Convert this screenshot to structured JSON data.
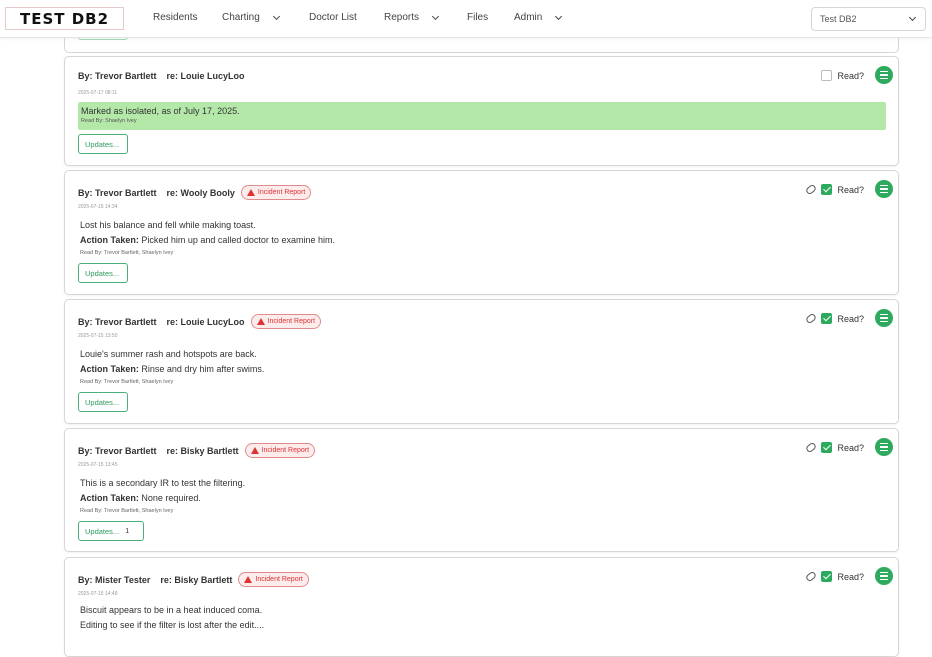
{
  "navbar": {
    "logo": "TEST DB2",
    "items": [
      {
        "label": "Residents",
        "has_dropdown": false
      },
      {
        "label": "Charting",
        "has_dropdown": true
      },
      {
        "label": "Doctor List",
        "has_dropdown": false
      },
      {
        "label": "Reports",
        "has_dropdown": true
      },
      {
        "label": "Files",
        "has_dropdown": false
      },
      {
        "label": "Admin",
        "has_dropdown": true
      }
    ],
    "site_select": "Test DB2"
  },
  "labels": {
    "read": "Read?",
    "updates": "Updates...",
    "incident_badge": "Incident Report",
    "action_taken": "Action Taken:"
  },
  "cards": [
    {
      "by": "By: Trevor Bartlett",
      "re": "re: Louie LucyLoo",
      "date": "2025-07-17 08:11",
      "incident": false,
      "isolated_message": "Marked as isolated, as of July 17, 2025.",
      "read_by": "Read By: Shaelyn Ivey",
      "read_checked": false,
      "updates_count": ""
    },
    {
      "by": "By: Trevor Bartlett",
      "re": "re: Wooly Booly",
      "date": "2025-07-15 14:34",
      "incident": true,
      "note": "Lost his balance and fell while making toast.",
      "action": "Picked him up and called doctor to examine him.",
      "read_by": "Read By: Trevor Bartlett, Shaelyn Ivey",
      "read_checked": true,
      "updates_count": ""
    },
    {
      "by": "By: Trevor Bartlett",
      "re": "re: Louie LucyLoo",
      "date": "2025-07-15 13:50",
      "incident": true,
      "note": "Louie's summer rash and hotspots are back.",
      "action": "Rinse and dry him after swims.",
      "read_by": "Read By: Trevor Bartlett, Shaelyn Ivey",
      "read_checked": true,
      "updates_count": ""
    },
    {
      "by": "By: Trevor Bartlett",
      "re": "re: Bisky Bartlett",
      "date": "2025-07-15 13:45",
      "incident": true,
      "note": "This is a secondary IR to test the filtering.",
      "action": "None required.",
      "read_by": "Read By: Trevor Bartlett, Shaelyn Ivey",
      "read_checked": true,
      "updates_count": "1"
    },
    {
      "by": "By: Mister Tester",
      "re": "re: Bisky Bartlett",
      "date": "2025-07-15 14:48",
      "incident": true,
      "note": "Biscuit appears to be in a heat induced coma.",
      "note2": "Editing to see if the filter is lost after the edit....",
      "read_checked": true,
      "updates_count": ""
    }
  ]
}
